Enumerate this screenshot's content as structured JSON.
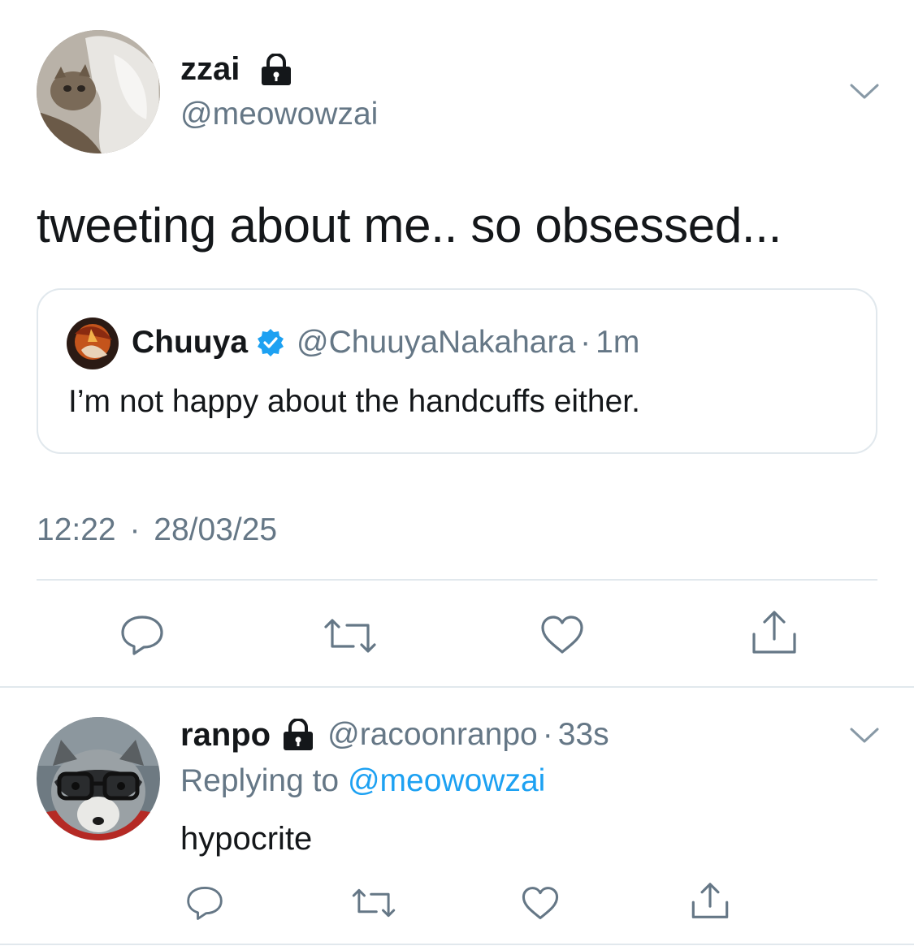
{
  "main_tweet": {
    "display_name": "zzai",
    "handle": "@meowowzai",
    "text": "tweeting about me.. so obsessed...",
    "timestamp_time": "12:22",
    "timestamp_sep": "·",
    "timestamp_date": "28/03/25",
    "avatar_icon": "cat-avatar",
    "locked_icon": "lock-icon",
    "menu_icon": "chevron-down-icon"
  },
  "quoted_tweet": {
    "display_name": "Chuuya",
    "handle": "@ChuuyaNakahara",
    "sep": "·",
    "time": "1m",
    "text": "I’m not happy about the handcuffs either.",
    "verified_icon": "verified-badge-icon"
  },
  "actions": [
    {
      "name": "reply",
      "icon": "reply-icon"
    },
    {
      "name": "retweet",
      "icon": "retweet-icon"
    },
    {
      "name": "like",
      "icon": "heart-icon"
    },
    {
      "name": "share",
      "icon": "share-icon"
    }
  ],
  "reply_tweet": {
    "display_name": "ranpo",
    "handle": "@racoonranpo",
    "sep": "·",
    "time": "33s",
    "replying_prefix": "Replying to",
    "replying_to": "@meowowzai",
    "text": "hypocrite"
  },
  "colors": {
    "text": "#14171a",
    "secondary": "#657786",
    "accent": "#1da1f2",
    "border": "#e1e8ed"
  }
}
